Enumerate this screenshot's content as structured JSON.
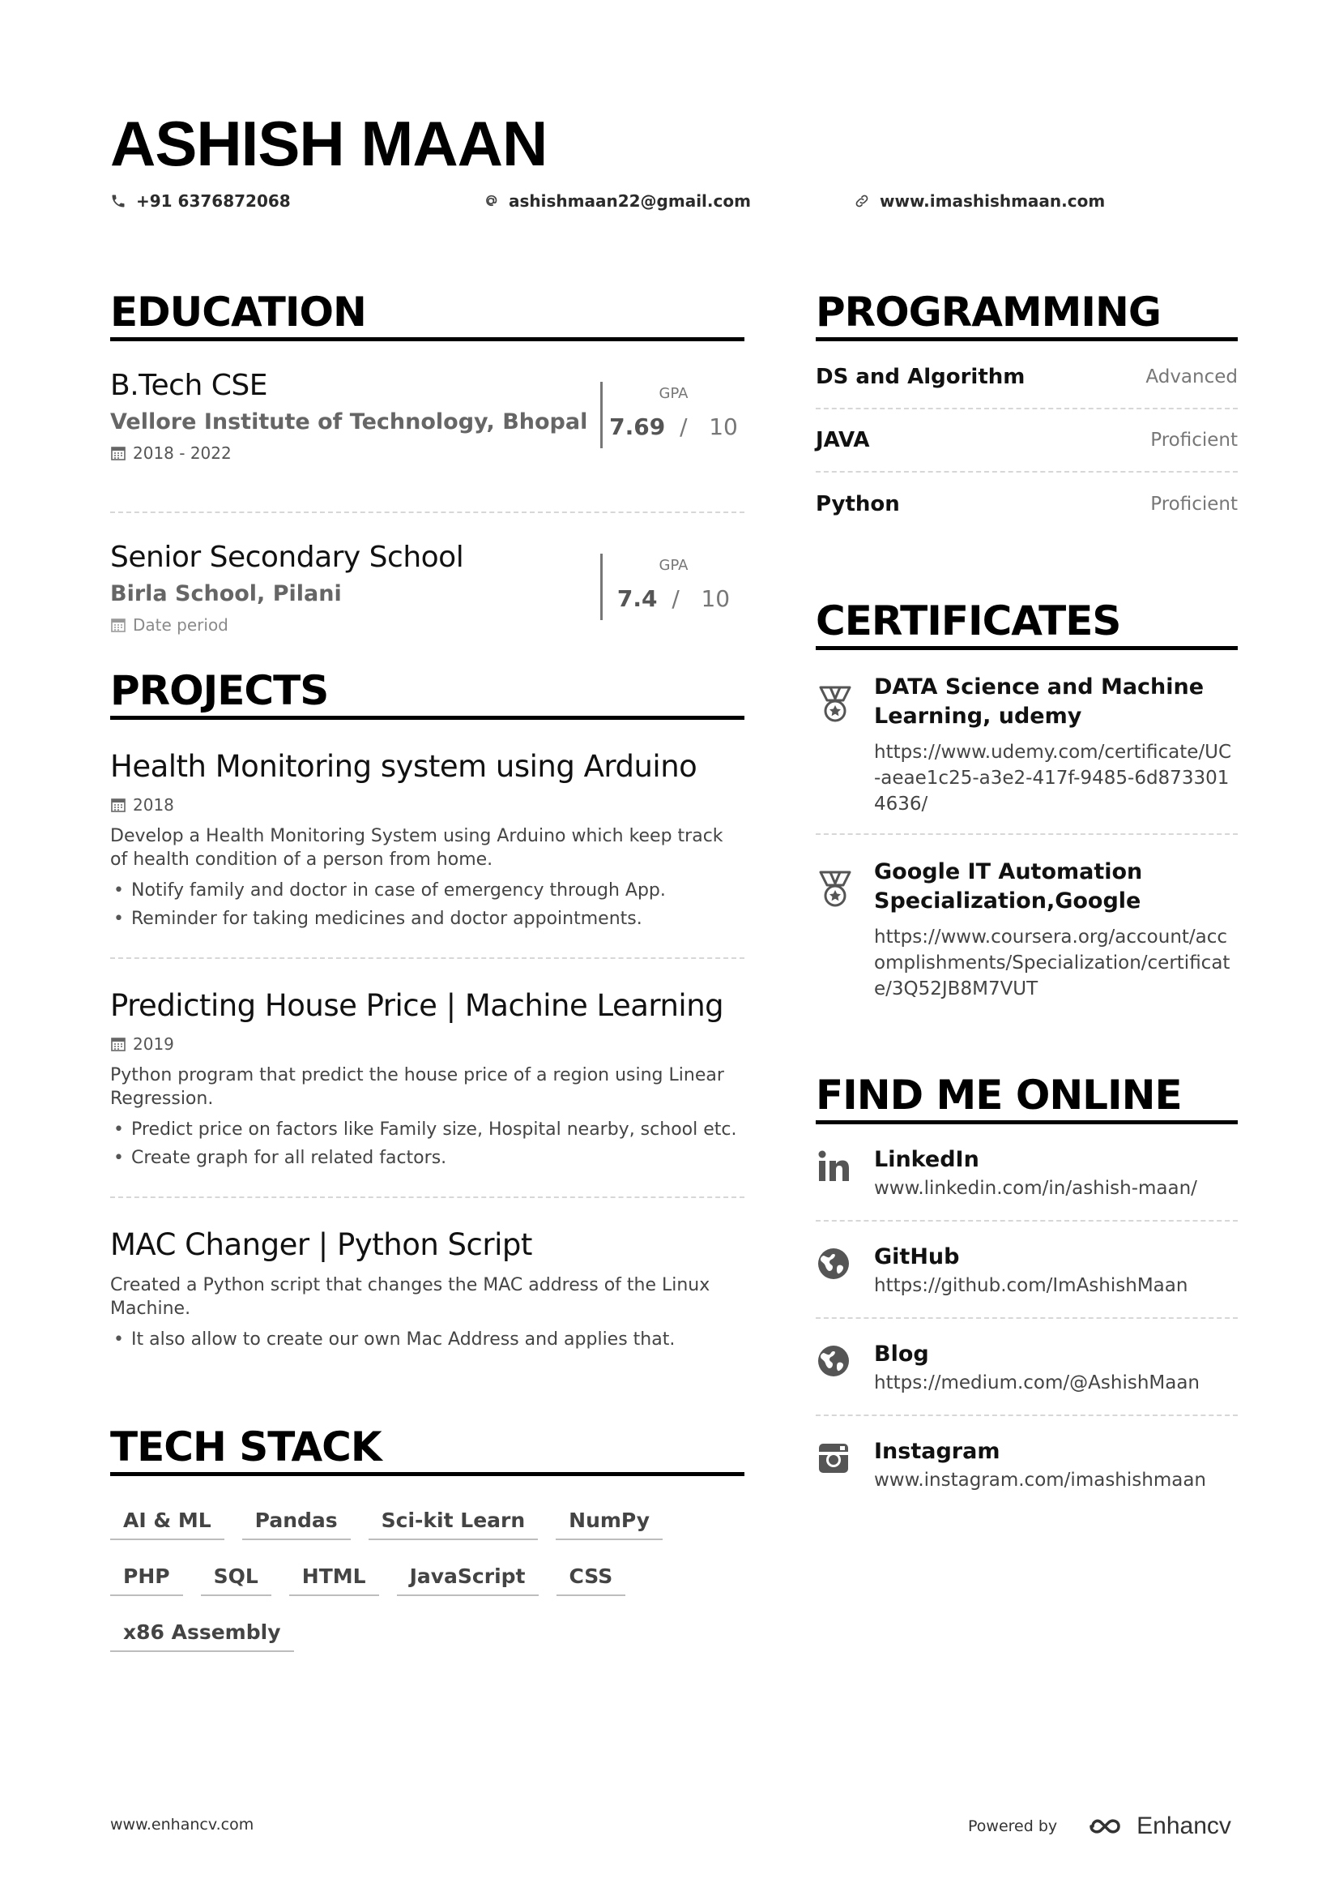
{
  "header": {
    "name": "ASHISH MAAN",
    "phone": "+91 6376872068",
    "email": "ashishmaan22@gmail.com",
    "website": "www.imashishmaan.com"
  },
  "education": {
    "title": "EDUCATION",
    "items": [
      {
        "degree": "B.Tech CSE",
        "institution": "Vellore Institute of Technology, Bhopal",
        "date": "2018 - 2022",
        "gpa_label": "GPA",
        "gpa": "7.69",
        "gpa_sep": "/",
        "gpa_max": "10"
      },
      {
        "degree": "Senior Secondary School",
        "institution": "Birla School, Pilani",
        "date": "Date period",
        "gpa_label": "GPA",
        "gpa": "7.4",
        "gpa_sep": "/",
        "gpa_max": "10"
      }
    ]
  },
  "projects": {
    "title": "PROJECTS",
    "items": [
      {
        "title": "Health Monitoring system using Arduino",
        "date": "2018",
        "desc": "Develop a Health Monitoring System using Arduino which keep track of health condition of a person from home.",
        "bullets": [
          "Notify family and doctor in case of emergency through App.",
          "Reminder for taking medicines and doctor appointments."
        ]
      },
      {
        "title": "Predicting House Price | Machine Learning",
        "date": "2019",
        "desc": "Python program that predict the house price of a region using Linear Regression.",
        "bullets": [
          "Predict price on factors like Family size, Hospital nearby, school etc.",
          "Create graph for all related factors."
        ]
      },
      {
        "title": "MAC Changer | Python Script",
        "desc": "Created a Python script that changes the MAC address of the Linux Machine.",
        "bullets": [
          "It also allow to create our own Mac Address and applies that."
        ]
      }
    ]
  },
  "tech_stack": {
    "title": "TECH STACK",
    "tags": [
      "AI & ML",
      "Pandas",
      "Sci-kit Learn",
      "NumPy",
      "PHP",
      "SQL",
      "HTML",
      "JavaScript",
      "CSS",
      "x86 Assembly"
    ]
  },
  "programming": {
    "title": "PROGRAMMING",
    "items": [
      {
        "name": "DS and Algorithm",
        "level": "Advanced"
      },
      {
        "name": "JAVA",
        "level": "Proficient"
      },
      {
        "name": "Python",
        "level": "Proficient"
      }
    ]
  },
  "certificates": {
    "title": "CERTIFICATES",
    "items": [
      {
        "title": "DATA Science and Machine Learning, udemy",
        "url": "https://www.udemy.com/certificate/UC-aeae1c25-a3e2-417f-9485-6d8733014636/",
        "icon": "medal-icon"
      },
      {
        "title": "Google IT Automation Specialization,Google",
        "url": "https://www.coursera.org/account/accomplishments/Specialization/certificate/3Q52JB8M7VUT",
        "icon": "medal-icon"
      }
    ]
  },
  "online": {
    "title": "FIND ME ONLINE",
    "items": [
      {
        "title": "LinkedIn",
        "url": "www.linkedin.com/in/ashish-maan/",
        "icon": "linkedin-icon"
      },
      {
        "title": "GitHub",
        "url": "https://github.com/ImAshishMaan",
        "icon": "globe-icon"
      },
      {
        "title": "Blog",
        "url": "https://medium.com/@AshishMaan",
        "icon": "globe-icon"
      },
      {
        "title": "Instagram",
        "url": "www.instagram.com/imashishmaan",
        "icon": "instagram-icon"
      }
    ]
  },
  "footer": {
    "site": "www.enhancv.com",
    "powered_by": "Powered by",
    "brand": "Enhancv"
  }
}
